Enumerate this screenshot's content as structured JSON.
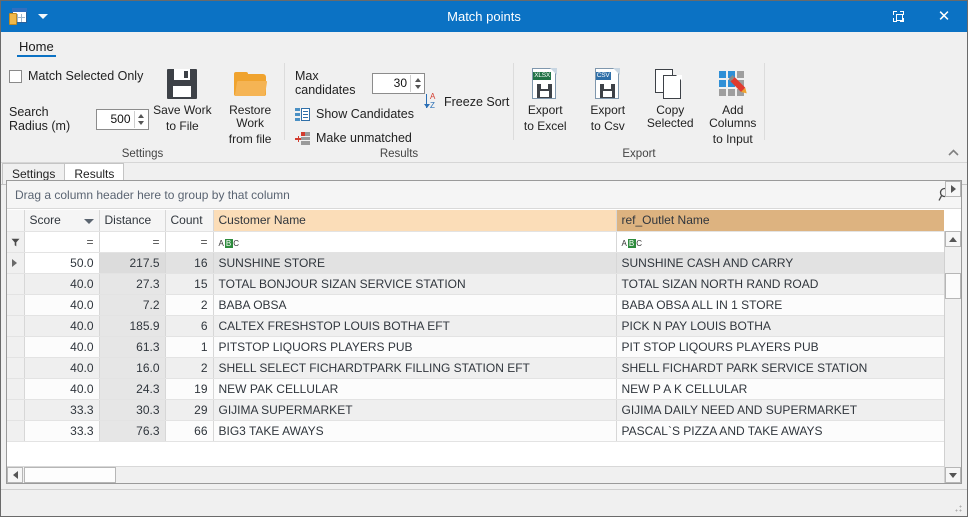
{
  "window": {
    "title": "Match points",
    "app_icon": "spreadsheet-icon",
    "quick_access_caret": "chevron-down-icon",
    "restore_label": "❐",
    "close_label": "✕"
  },
  "ribbon": {
    "tabs": [
      {
        "label": "Home",
        "active": true
      }
    ],
    "collapse_icon": "chevron-up-icon",
    "groups": [
      {
        "title": "Settings",
        "checkbox": {
          "label": "Match Selected Only",
          "checked": false
        },
        "search_radius": {
          "label": "Search Radius (m)",
          "value": "500"
        },
        "buttons": [
          {
            "label_line1": "Save Work",
            "label_line2": "to File",
            "icon": "floppy-disk-icon"
          },
          {
            "label_line1": "Restore Work",
            "label_line2": "from file",
            "icon": "open-folder-icon"
          }
        ]
      },
      {
        "title": "Results",
        "max_candidates": {
          "label": "Max candidates",
          "value": "30"
        },
        "show_candidates": {
          "label": "Show Candidates",
          "icon": "show-candidates-icon"
        },
        "make_unmatched": {
          "label": "Make unmatched",
          "icon": "make-unmatched-icon"
        },
        "freeze_sort": {
          "label": "Freeze Sort",
          "icon": "sort-az-icon"
        }
      },
      {
        "title": "Export",
        "buttons": [
          {
            "label_line1": "Export",
            "label_line2": "to Excel",
            "icon": "xlsx-file-icon",
            "badge": "XLSX"
          },
          {
            "label_line1": "Export",
            "label_line2": "to Csv",
            "icon": "csv-file-icon",
            "badge": "CSV"
          },
          {
            "label_line1": "Copy Selected",
            "label_line2": "",
            "icon": "copy-icon"
          },
          {
            "label_line1": "Add Columns",
            "label_line2": "to Input",
            "icon": "add-columns-icon"
          }
        ]
      }
    ]
  },
  "doc_tabs": [
    {
      "label": "Settings",
      "active": false
    },
    {
      "label": "Results",
      "active": true
    }
  ],
  "grid": {
    "group_panel_text": "Drag a column header here to group by that column",
    "search_icon": "magnifier-icon",
    "columns": [
      {
        "key": "score",
        "label": "Score",
        "sorted": true,
        "sort_dir": "desc"
      },
      {
        "key": "distance",
        "label": "Distance"
      },
      {
        "key": "count",
        "label": "Count"
      },
      {
        "key": "customer",
        "label": "Customer Name",
        "header_color": "#fbddb8"
      },
      {
        "key": "ref",
        "label": "ref_Outlet Name",
        "header_color": "#ddb380"
      }
    ],
    "filter_row": {
      "score": "=",
      "distance": "=",
      "count": "=",
      "customer": "abc",
      "ref": "abc"
    },
    "rows": [
      {
        "score": "50.0",
        "distance": "217.5",
        "count": "16",
        "customer": "SUNSHINE STORE",
        "ref": "SUNSHINE CASH AND CARRY",
        "selected": true
      },
      {
        "score": "40.0",
        "distance": "27.3",
        "count": "15",
        "customer": "TOTAL BONJOUR SIZAN SERVICE STATION",
        "ref": "TOTAL SIZAN NORTH RAND ROAD"
      },
      {
        "score": "40.0",
        "distance": "7.2",
        "count": "2",
        "customer": "BABA OBSA",
        "ref": "BABA OBSA ALL IN 1 STORE"
      },
      {
        "score": "40.0",
        "distance": "185.9",
        "count": "6",
        "customer": "CALTEX FRESHSTOP LOUIS BOTHA EFT",
        "ref": "PICK N PAY LOUIS BOTHA"
      },
      {
        "score": "40.0",
        "distance": "61.3",
        "count": "1",
        "customer": "PITSTOP LIQUORS PLAYERS PUB",
        "ref": "PIT STOP LIQOURS PLAYERS PUB"
      },
      {
        "score": "40.0",
        "distance": "16.0",
        "count": "2",
        "customer": "SHELL SELECT FICHARDTPARK FILLING STATION EFT",
        "ref": "SHELL FICHARDT PARK SERVICE STATION"
      },
      {
        "score": "40.0",
        "distance": "24.3",
        "count": "19",
        "customer": "NEW PAK CELLULAR",
        "ref": "NEW P A K CELLULAR"
      },
      {
        "score": "33.3",
        "distance": "30.3",
        "count": "29",
        "customer": "GIJIMA SUPERMARKET",
        "ref": "GIJIMA DAILY NEED AND SUPERMARKET"
      },
      {
        "score": "33.3",
        "distance": "76.3",
        "count": "66",
        "customer": "BIG3 TAKE AWAYS",
        "ref": "PASCAL`S PIZZA AND TAKE AWAYS"
      }
    ]
  },
  "colors": {
    "titlebar": "#0b72c4",
    "accent": "#0b72c4",
    "customer_header": "#fbddb8",
    "ref_header": "#ddb380",
    "window_bg": "#f0f0f0"
  }
}
